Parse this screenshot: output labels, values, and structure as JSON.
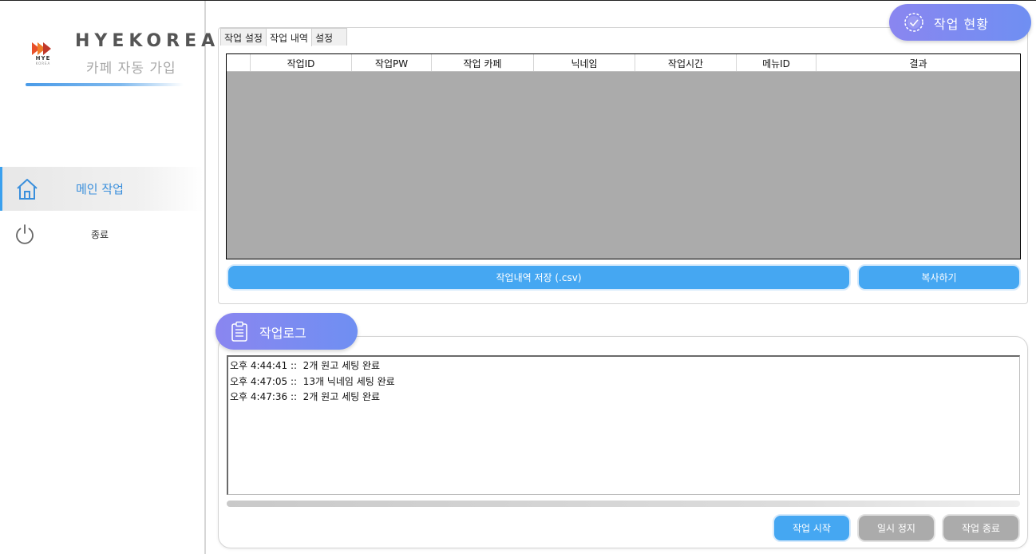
{
  "app": {
    "brand": "HYEKOREA",
    "subtitle": "카페 자동 가입",
    "logo_mini": "HYE",
    "logo_mini2": "KOREA"
  },
  "sidebar": {
    "items": [
      {
        "label": "메인 작업",
        "icon": "home-icon",
        "active": true
      },
      {
        "label": "종료",
        "icon": "power-icon",
        "active": false
      }
    ]
  },
  "status_panel": {
    "badge": "작업 현황",
    "tabs": [
      {
        "label": "작업 설정",
        "active": false
      },
      {
        "label": "작업 내역",
        "active": true
      },
      {
        "label": "설정",
        "active": false
      }
    ],
    "table": {
      "columns": [
        "",
        "작업ID",
        "작업PW",
        "작업 카페",
        "닉네임",
        "작업시간",
        "메뉴ID",
        "결과"
      ],
      "rows": []
    },
    "save_button": "작업내역 저장 (.csv)",
    "copy_button": "복사하기"
  },
  "log_panel": {
    "badge": "작업로그",
    "lines": [
      "오후 4:44:41 ::  2개 원고 세팅 완료",
      "오후 4:47:05 ::  13개 닉네임 세팅 완료",
      "오후 4:47:36 ::  2개 원고 세팅 완료"
    ]
  },
  "actions": {
    "start": "작업 시작",
    "pause": "일시 정지",
    "stop": "작업 종료"
  },
  "colors": {
    "accent": "#45a7f2",
    "badge_gradient_start": "#8a86f0",
    "badge_gradient_end": "#6f8ff2",
    "disabled": "#ababab",
    "grid_background": "#ababab"
  }
}
